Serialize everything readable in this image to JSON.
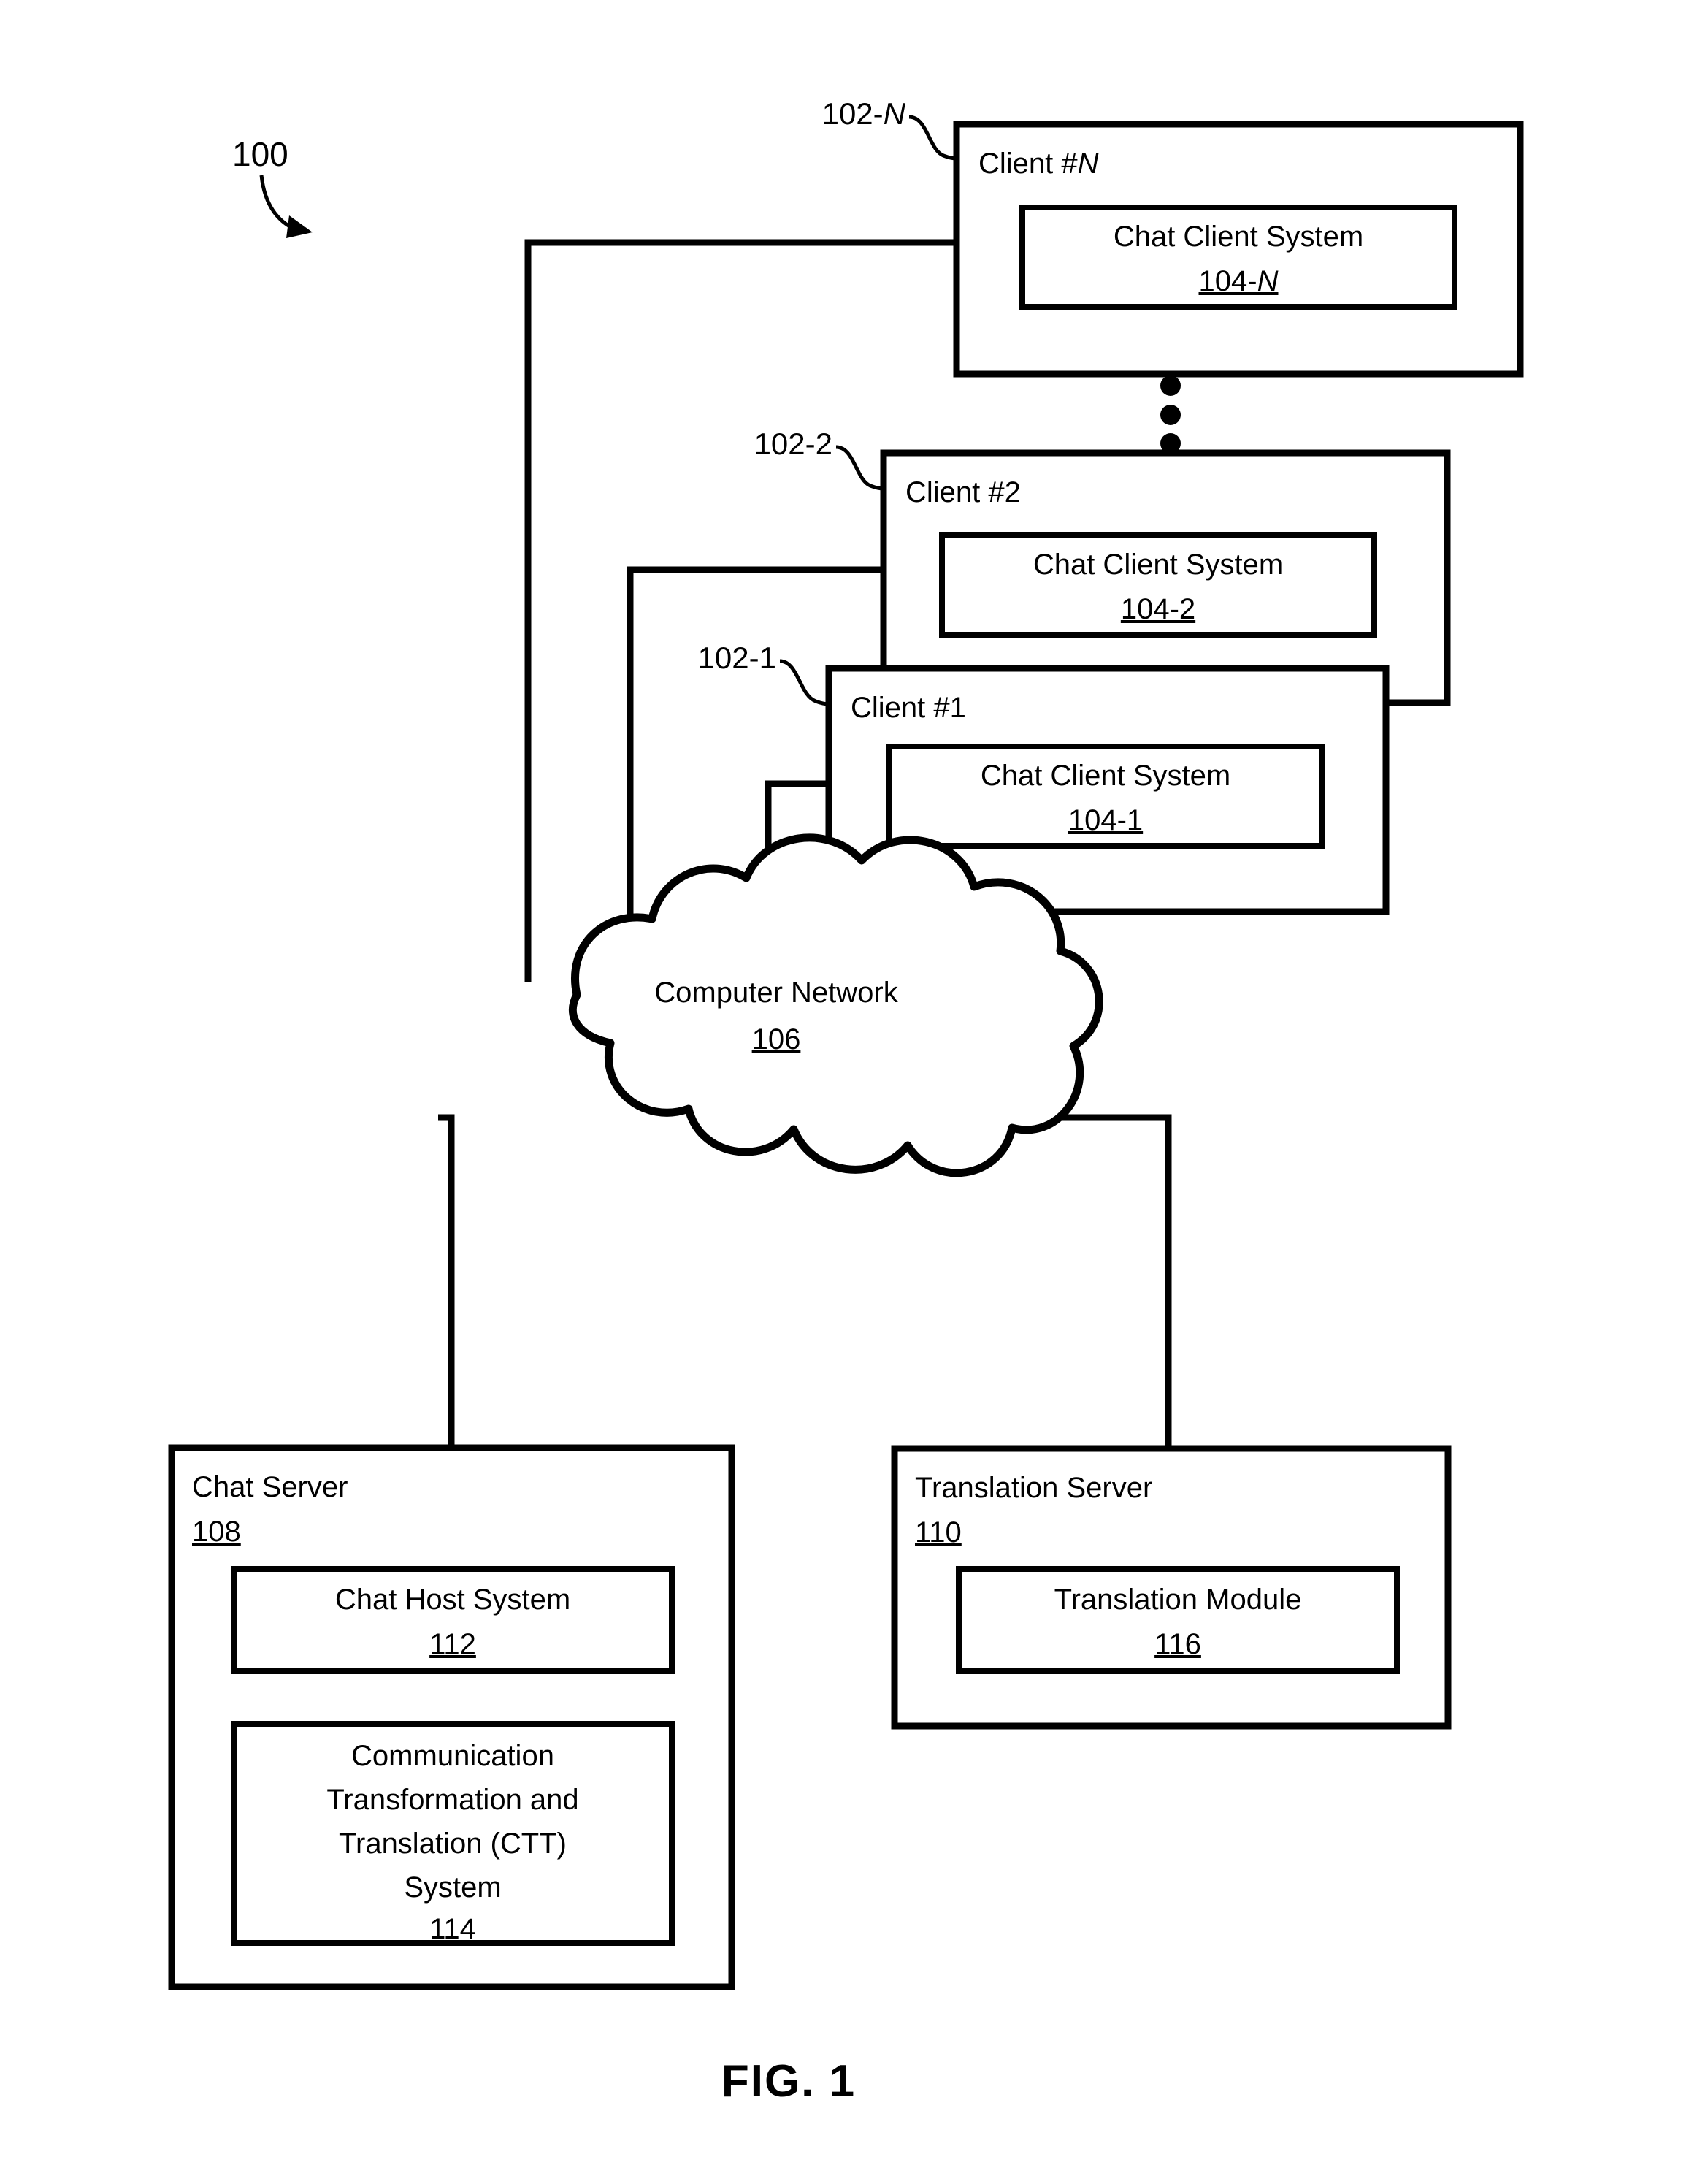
{
  "figure": {
    "caption": "FIG. 1",
    "system_label": "100"
  },
  "leaders": {
    "client_n": "102-N",
    "client_2": "102-2",
    "client_1": "102-1"
  },
  "nodes": {
    "client_n": {
      "title": "Client #N",
      "inner": {
        "title": "Chat Client System",
        "ref": "104-N"
      }
    },
    "client_2": {
      "title": "Client #2",
      "inner": {
        "title": "Chat Client System",
        "ref": "104-2"
      }
    },
    "client_1": {
      "title": "Client #1",
      "inner": {
        "title": "Chat Client System",
        "ref": "104-1"
      }
    },
    "network": {
      "title": "Computer Network",
      "ref": "106"
    },
    "chat_server": {
      "title": "Chat Server",
      "ref": "108",
      "modules": [
        {
          "title": "Chat Host System",
          "ref": "112"
        },
        {
          "title_lines": [
            "Communication",
            "Transformation and",
            "Translation (CTT)",
            "System"
          ],
          "ref": "114"
        }
      ]
    },
    "translation_server": {
      "title": "Translation Server",
      "ref": "110",
      "modules": [
        {
          "title": "Translation Module",
          "ref": "116"
        }
      ]
    }
  },
  "ellipsis": {
    "name": "vertical-ellipsis",
    "count": 3
  },
  "colors": {
    "stroke": "#000000",
    "background": "#ffffff"
  }
}
